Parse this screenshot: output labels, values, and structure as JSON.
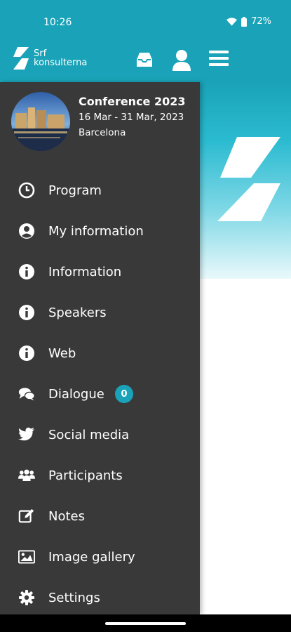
{
  "status": {
    "time": "10:26",
    "battery": "72%"
  },
  "appbar": {
    "logo_line1": "Srf",
    "logo_line2": "konsulterna",
    "icons": [
      "inbox-icon",
      "user-icon",
      "menu-icon"
    ]
  },
  "event": {
    "title": "Conference 2023",
    "dates": "16 Mar - 31 Mar, 2023",
    "city": "Barcelona"
  },
  "menu": [
    {
      "label": "Program",
      "icon": "clock-icon"
    },
    {
      "label": "My information",
      "icon": "user-circle-icon"
    },
    {
      "label": "Information",
      "icon": "info-icon"
    },
    {
      "label": "Speakers",
      "icon": "info-icon"
    },
    {
      "label": "Web",
      "icon": "info-icon"
    },
    {
      "label": "Dialogue",
      "icon": "chat-icon",
      "badge": "0"
    },
    {
      "label": "Social media",
      "icon": "twitter-icon"
    },
    {
      "label": "Participants",
      "icon": "users-icon"
    },
    {
      "label": "Notes",
      "icon": "edit-icon"
    },
    {
      "label": "Image gallery",
      "icon": "image-icon"
    },
    {
      "label": "Settings",
      "icon": "gear-icon"
    }
  ],
  "colors": {
    "brand": "#1aa3b8",
    "drawer": "#393939"
  }
}
